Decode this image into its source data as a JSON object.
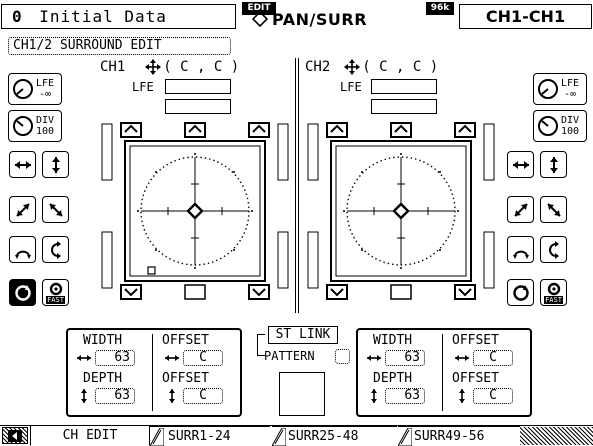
{
  "header": {
    "scene_number": "0",
    "scene_name": "Initial Data",
    "edit_badge": "EDIT",
    "page_title": "PAN/SURR",
    "rate_badge": "96k",
    "channel_range": "CH1-CH1"
  },
  "section_title": "CH1/2 SURROUND EDIT",
  "ch1": {
    "label": "CH1",
    "position": "( C , C )",
    "lfe_label": "LFE"
  },
  "ch2": {
    "label": "CH2",
    "position": "( C , C )",
    "lfe_label": "LFE"
  },
  "knobs": {
    "lfe": {
      "label": "LFE",
      "value": "-∞"
    },
    "div": {
      "label": "DIV",
      "value": "100"
    }
  },
  "fast_label": "FAST",
  "params_left": {
    "width_label": "WIDTH",
    "width_value": "63",
    "depth_label": "DEPTH",
    "depth_value": "63",
    "offset1_label": "OFFSET",
    "offset1_value": "C",
    "offset2_label": "OFFSET",
    "offset2_value": "C"
  },
  "params_right": {
    "width_label": "WIDTH",
    "width_value": "63",
    "depth_label": "DEPTH",
    "depth_value": "63",
    "offset1_label": "OFFSET",
    "offset1_value": "C",
    "offset2_label": "OFFSET",
    "offset2_value": "C"
  },
  "st_link_label": "ST LINK",
  "pattern_label": "PATTERN",
  "tabs": [
    {
      "label": "CH EDIT",
      "active": true
    },
    {
      "label": "SURR1-24",
      "active": false
    },
    {
      "label": "SURR25-48",
      "active": false
    },
    {
      "label": "SURR49-56",
      "active": false
    }
  ]
}
